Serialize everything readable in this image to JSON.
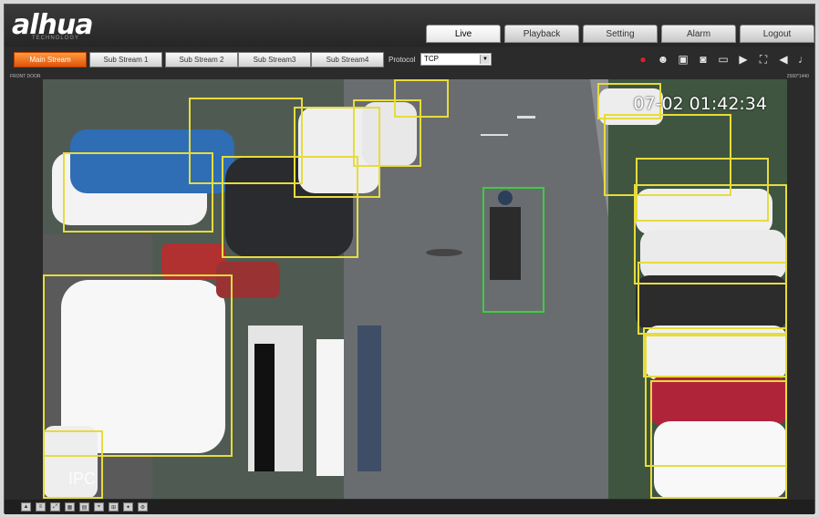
{
  "brand": {
    "logo_text": "alhua",
    "sub_text": "TECHNOLOGY"
  },
  "nav": {
    "tabs": [
      {
        "label": "Live",
        "active": true
      },
      {
        "label": "Playback",
        "active": false
      },
      {
        "label": "Setting",
        "active": false
      },
      {
        "label": "Alarm",
        "active": false
      },
      {
        "label": "Logout",
        "active": false
      }
    ]
  },
  "toolbar": {
    "streams": [
      {
        "label": "Main Stream",
        "active": true
      },
      {
        "label": "Sub Stream 1",
        "active": false
      },
      {
        "label": "Sub Stream 2",
        "active": false
      },
      {
        "label": "Sub Stream3",
        "active": false
      },
      {
        "label": "Sub Stream4",
        "active": false
      }
    ],
    "protocol_label": "Protocol",
    "protocol_value": "TCP",
    "tool_icons": [
      "alarm-light-icon",
      "person-icon",
      "snapshot-icon",
      "record-icon",
      "zoom-icon",
      "video-icon",
      "fullscreen-icon",
      "speaker-icon",
      "mic-icon"
    ]
  },
  "video": {
    "timestamp": "07-02 01:42:34",
    "corner_left": "FRONT DOOR",
    "corner_right": "2560*1440",
    "watermark": "IPC"
  },
  "bottom_icons": [
    "rule-icon",
    "fps-icon",
    "stretch-icon",
    "stream-icon",
    "ratio-icon",
    "tracking-icon",
    "zoom-icon",
    "ptz-icon",
    "settings-icon"
  ],
  "colors": {
    "accent": "#e0540c",
    "vehicle_box": "#e6dc3c",
    "person_box": "#3ccd3c"
  }
}
